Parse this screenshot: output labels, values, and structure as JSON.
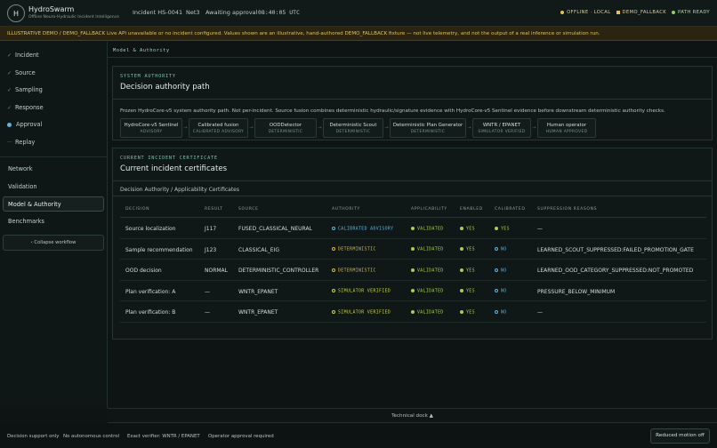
{
  "header": {
    "logo_letter": "H",
    "app_name": "HydroSwarm",
    "app_subtitle": "Offline Neuro-Hydraulic Incident Intelligence",
    "incident": "Incident HS-0041",
    "network": "Net3",
    "state": "Awaiting approval",
    "clock": "08:40:05 UTC",
    "status": [
      {
        "label": "OFFLINE · LOCAL",
        "color": "#e0c25a",
        "shape": "dot"
      },
      {
        "label": "DEMO_FALLBACK",
        "color": "#e0c25a",
        "shape": "square"
      },
      {
        "label": "PATH READY",
        "color": "#8fd06a",
        "shape": "dot"
      }
    ]
  },
  "banner": "ILLUSTRATIVE DEMO / DEMO_FALLBACK  Live API unavailable or no incident configured. Values shown are an illustrative, hand-authored DEMO_FALLBACK fixture — not live telemetry, and not the output of a real inference or simulation run.",
  "sidebar": {
    "workflow": [
      {
        "label": "Incident",
        "mark": "✓"
      },
      {
        "label": "Source",
        "mark": "✓"
      },
      {
        "label": "Sampling",
        "mark": "✓"
      },
      {
        "label": "Response",
        "mark": "✓"
      },
      {
        "label": "Approval",
        "mark": "dot"
      },
      {
        "label": "Replay",
        "mark": "···"
      }
    ],
    "views": [
      "Network",
      "Validation",
      "Model & Authority",
      "Benchmarks"
    ],
    "active_view": "Model & Authority",
    "collapse_label": "‹ Collapse workflow"
  },
  "main": {
    "breadcrumb": "Model & Authority",
    "authority": {
      "kicker": "SYSTEM AUTHORITY",
      "title": "Decision authority path",
      "description": "Frozen HydroCore-v5 system authority path. Not per-incident. Source fusion combines deterministic hydraulic/signature evidence with HydroCore-v5 Sentinel evidence before downstream deterministic authority checks.",
      "flow": [
        {
          "name": "HydroCore-v5 Sentinel",
          "role": "ADVISORY"
        },
        {
          "name": "Calibrated fusion",
          "role": "CALIBRATED ADVISORY"
        },
        {
          "name": "OODDetector",
          "role": "DETERMINISTIC"
        },
        {
          "name": "Deterministic Scout",
          "role": "DETERMINISTIC"
        },
        {
          "name": "Deterministic Plan Generator",
          "role": "DETERMINISTIC"
        },
        {
          "name": "WNTR / EPANET",
          "role": "SIMULATOR VERIFIED"
        },
        {
          "name": "Human operator",
          "role": "HUMAN APPROVED"
        }
      ]
    },
    "certificates": {
      "kicker": "CURRENT INCIDENT CERTIFICATE",
      "title": "Current incident certificates",
      "subtitle": "Decision Authority / Applicability Certificates",
      "columns": [
        "DECISION",
        "RESULT",
        "SOURCE",
        "AUTHORITY",
        "APPLICABILITY",
        "ENABLED",
        "CALIBRATED",
        "SUPPRESSION REASONS"
      ],
      "rows": [
        {
          "decision": "Source localization",
          "result": "J117",
          "source": "FUSED_CLASSICAL_NEURAL",
          "authority": "CALIBRATED ADVISORY",
          "authority_color": "#5fb3d9",
          "applicability": "VALIDATED",
          "enabled": "YES",
          "calibrated": "YES",
          "calibrated_state": "yes",
          "suppression": "—"
        },
        {
          "decision": "Sample recommendation",
          "result": "J123",
          "source": "CLASSICAL_EIG",
          "authority": "DETERMINISTIC",
          "authority_color": "#d8b84a",
          "applicability": "VALIDATED",
          "enabled": "YES",
          "calibrated": "NO",
          "calibrated_state": "no",
          "suppression": "LEARNED_SCOUT_SUPPRESSED:FAILED_PROMOTION_GATE"
        },
        {
          "decision": "OOD decision",
          "result": "NORMAL",
          "source": "DETERMINISTIC_CONTROLLER",
          "authority": "DETERMINISTIC",
          "authority_color": "#d8b84a",
          "applicability": "VALIDATED",
          "enabled": "YES",
          "calibrated": "NO",
          "calibrated_state": "no",
          "suppression": "LEARNED_OOD_CATEGORY_SUPPRESSED:NOT_PROMOTED"
        },
        {
          "decision": "Plan verification: A",
          "result": "—",
          "source": "WNTR_EPANET",
          "authority": "SIMULATOR VERIFIED",
          "authority_color": "#c8d24a",
          "applicability": "VALIDATED",
          "enabled": "YES",
          "calibrated": "NO",
          "calibrated_state": "no",
          "suppression": "PRESSURE_BELOW_MINIMUM"
        },
        {
          "decision": "Plan verification: B",
          "result": "—",
          "source": "WNTR_EPANET",
          "authority": "SIMULATOR VERIFIED",
          "authority_color": "#c8d24a",
          "applicability": "VALIDATED",
          "enabled": "YES",
          "calibrated": "NO",
          "calibrated_state": "no",
          "suppression": "—"
        }
      ]
    }
  },
  "technical_dock": "Technical dock ▲",
  "footer": {
    "items": [
      "Decision support only",
      "No autonomous control",
      "Exact verifier: WNTR / EPANET",
      "Operator approval required"
    ],
    "motion_button": "Reduced motion off"
  }
}
